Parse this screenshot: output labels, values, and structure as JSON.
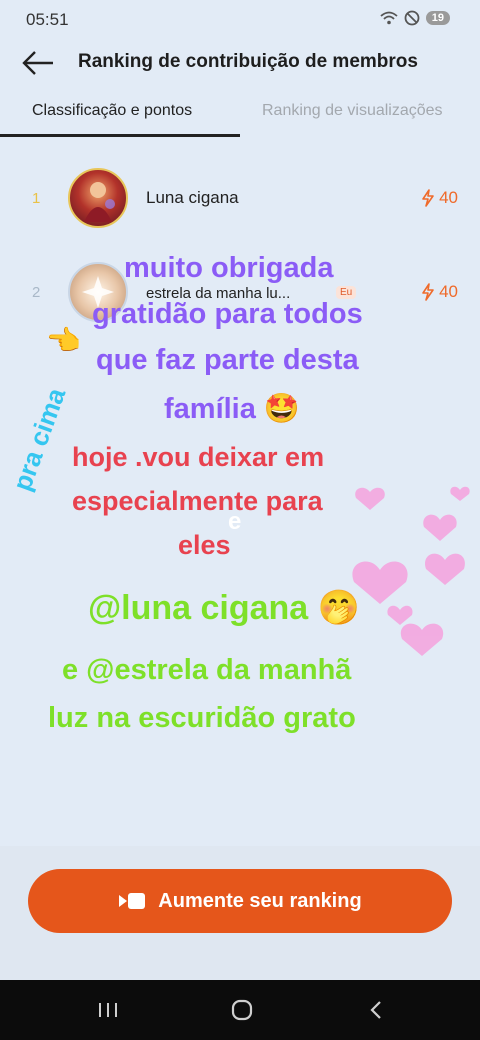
{
  "status_bar": {
    "time": "05:51",
    "battery": "19"
  },
  "header": {
    "title": "Ranking de contribuição de membros"
  },
  "tabs": [
    {
      "label": "Classificação e pontos",
      "active": true
    },
    {
      "label": "Ranking de visualizações",
      "active": false
    }
  ],
  "ranking": [
    {
      "rank": "1",
      "name": "Luna cigana",
      "points": "40",
      "badge": ""
    },
    {
      "rank": "2",
      "name": "estrela da manha lu...",
      "points": "40",
      "badge": "Eu"
    }
  ],
  "overlay_text": {
    "line1": "muito obrigada",
    "line2": "gratidão para todos",
    "line3": "que faz parte desta",
    "line4": "família 🤩",
    "side": "pra cima",
    "line5": "hoje .vou deixar em",
    "line6": "especialmente para",
    "line6b": "e",
    "line7": "eles",
    "line8": "@luna cigana 🤭",
    "line9": "e @estrela da manhã",
    "line10": "luz na escuridão grato"
  },
  "cta": {
    "label": "Aumente seu ranking"
  },
  "colors": {
    "accent": "#e5561b",
    "points": "#ef6a2a",
    "purple": "#8b5cf6",
    "red": "#e8424f",
    "green": "#7ee029",
    "cyan": "#35c6f0"
  }
}
